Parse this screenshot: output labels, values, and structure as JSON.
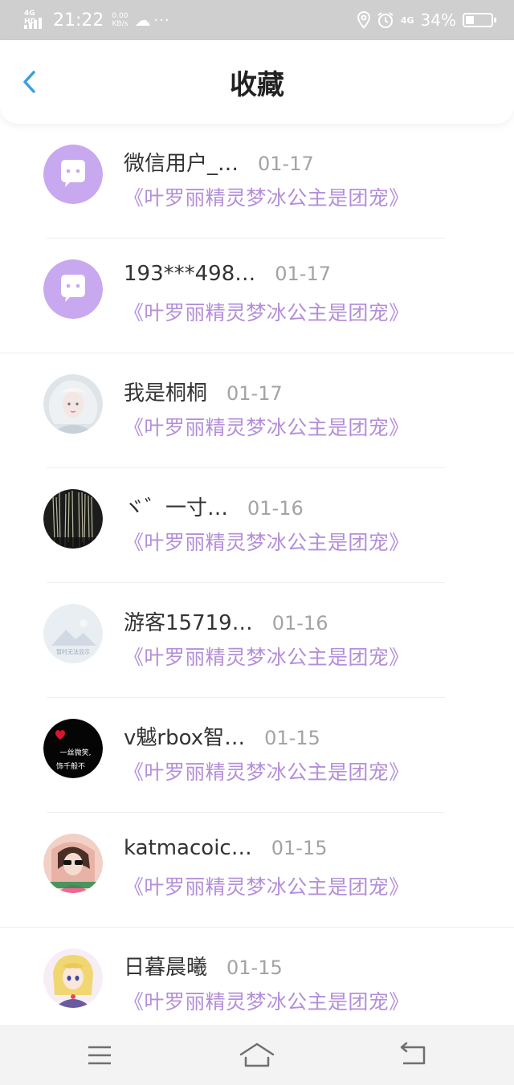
{
  "status_bar": {
    "network": "4G HD",
    "time": "21:22",
    "speed_value": "0.00",
    "speed_unit": "KB/s",
    "right_network": "4G",
    "battery_percent": "34%",
    "battery_level": 0.34
  },
  "header": {
    "title": "收藏"
  },
  "items": [
    {
      "name": "微信用户_…",
      "date": "01-17",
      "book": "《叶罗丽精灵梦冰公主是团宠》",
      "avatar": "default-avatar"
    },
    {
      "name": "193***498…",
      "date": "01-17",
      "book": "《叶罗丽精灵梦冰公主是团宠》",
      "avatar": "default-avatar"
    },
    {
      "name": "我是桐桐",
      "date": "01-17",
      "book": "《叶罗丽精灵梦冰公主是团宠》",
      "avatar": "photo-avatar"
    },
    {
      "name": "ヾ゛一寸…",
      "date": "01-16",
      "book": "《叶罗丽精灵梦冰公主是团宠》",
      "avatar": "photo-avatar"
    },
    {
      "name": "游客15719…",
      "date": "01-16",
      "book": "《叶罗丽精灵梦冰公主是团宠》",
      "avatar": "placeholder-avatar"
    },
    {
      "name": "v魆rbox智…",
      "date": "01-15",
      "book": "《叶罗丽精灵梦冰公主是团宠》",
      "avatar": "photo-avatar"
    },
    {
      "name": "katmacoic…",
      "date": "01-15",
      "book": "《叶罗丽精灵梦冰公主是团宠》",
      "avatar": "photo-avatar"
    },
    {
      "name": "日暮晨曦",
      "date": "01-15",
      "book": "《叶罗丽精灵梦冰公主是团宠》",
      "avatar": "photo-avatar"
    }
  ],
  "avatar_text": {
    "placeholder": "暂时无法显示",
    "quote_line1": "一丝微笑,",
    "quote_line2": "饰千般不"
  },
  "colors": {
    "accent_blue": "#3a9ee4",
    "book_purple": "#b48fd9",
    "avatar_purple": "#c8a8ee",
    "status_bar_bg": "#cfcfcf"
  },
  "navigation": {
    "menu_icon": "menu-icon",
    "home_icon": "home-icon",
    "back_icon": "return-icon"
  }
}
